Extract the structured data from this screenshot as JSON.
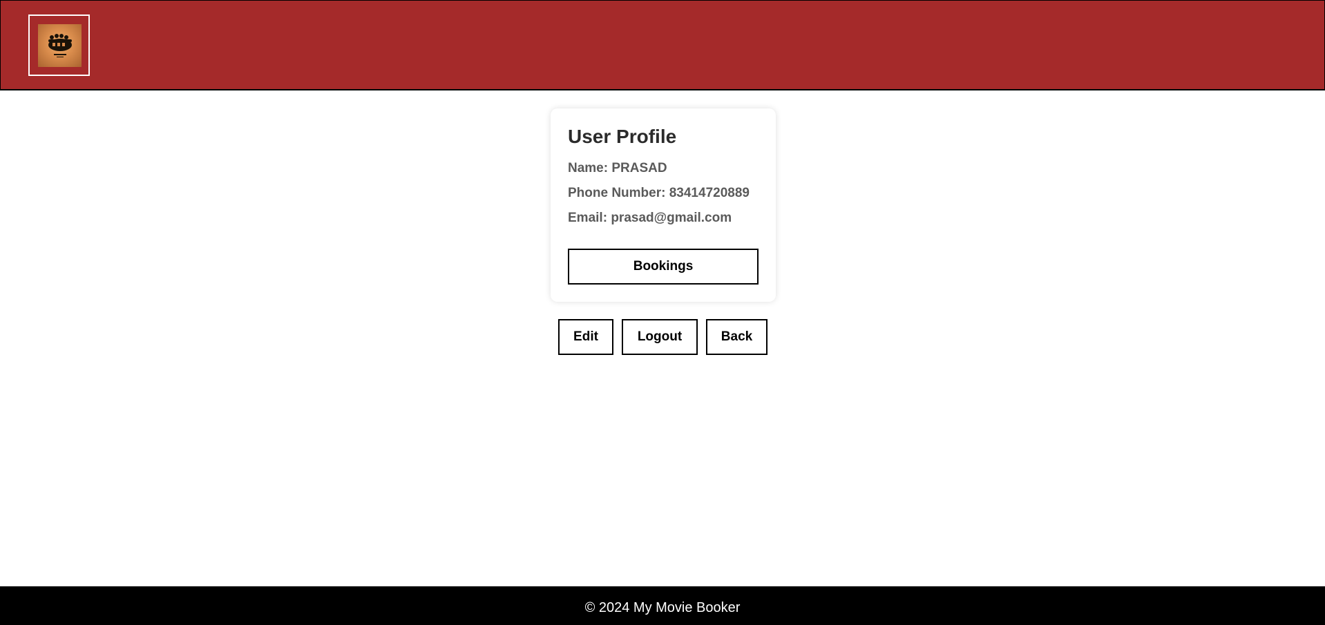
{
  "header": {
    "logo_icon": "movie-reel-logo-icon",
    "background_color": "#a52a2a"
  },
  "profile": {
    "title": "User Profile",
    "name_label": "Name:",
    "name_value": "PRASAD",
    "phone_label": "Phone Number:",
    "phone_value": "83414720889",
    "email_label": "Email:",
    "email_value": "prasad@gmail.com",
    "bookings_label": "Bookings"
  },
  "actions": {
    "edit_label": "Edit",
    "logout_label": "Logout",
    "back_label": "Back"
  },
  "footer": {
    "text": "© 2024 My Movie Booker"
  }
}
